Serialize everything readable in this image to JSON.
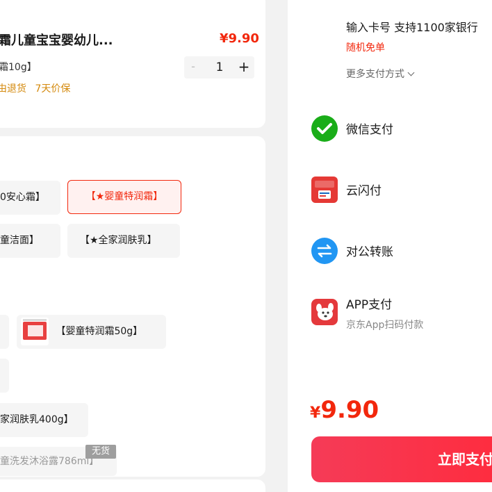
{
  "product": {
    "title": "面霜儿童宝宝婴幼儿...",
    "price": "¥9.90",
    "spec": "霜10g】",
    "quantity": "1",
    "minus": "-",
    "plus": "+",
    "services": [
      "由退货",
      "7天价保"
    ]
  },
  "options": {
    "row1": [
      "0安心霜】",
      "【★婴童特润霜】"
    ],
    "row2": [
      "童洁面】",
      "【★全家润肤乳】"
    ],
    "row3_named": "【婴童特润霜50g】",
    "row4": "家润肤乳400g】",
    "row5": "童洗发沐浴露786ml】",
    "nostock": "无货"
  },
  "payment": {
    "card_hint": "输入卡号 支持1100家银行",
    "promo": "随机免单",
    "more": "更多支付方式",
    "methods": [
      {
        "label": "微信支付",
        "icon": "wechat-pay-icon"
      },
      {
        "label": "云闪付",
        "icon": "unionpay-quickpass-icon"
      },
      {
        "label": "对公转账",
        "icon": "transfer-icon"
      },
      {
        "label": "APP支付",
        "sub": "京东App扫码付款",
        "icon": "jd-app-icon"
      }
    ],
    "total_currency": "¥",
    "total_amount": "9.90",
    "pay_button": "立即支付"
  },
  "colors": {
    "accent": "#f2270c",
    "service": "#d4890c",
    "wechat": "#1aad19",
    "unionpay": "#e53935",
    "transfer": "#2196f3",
    "button": "#f53b57"
  }
}
